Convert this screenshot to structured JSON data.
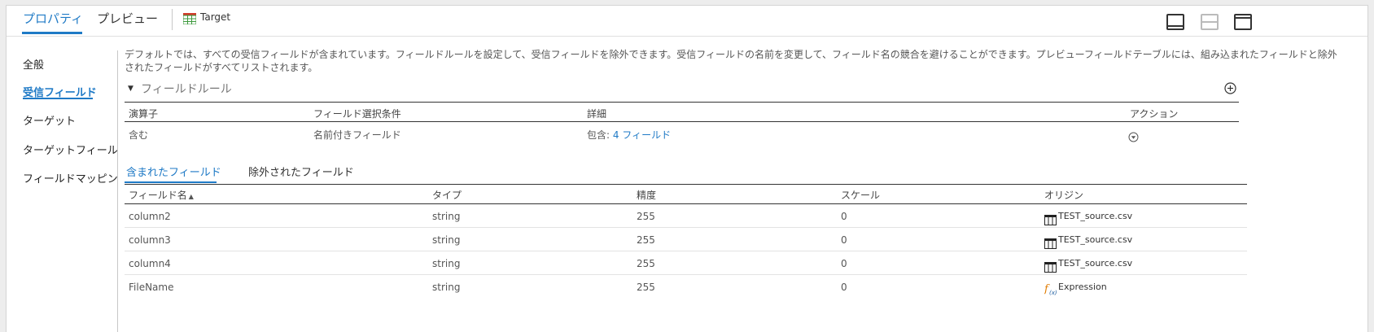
{
  "header": {
    "tabs": [
      {
        "label": "プロパティ",
        "active": true
      },
      {
        "label": "プレビュー",
        "active": false
      }
    ],
    "target": {
      "label": "Target",
      "icon": "target-table-icon"
    },
    "window_controls": [
      "dock-bottom-icon",
      "split-view-icon",
      "dock-top-icon"
    ]
  },
  "sidebar": {
    "items": [
      {
        "label": "全般",
        "active": false
      },
      {
        "label": "受信フィールド",
        "active": true
      },
      {
        "label": "ターゲット",
        "active": false
      },
      {
        "label": "ターゲットフィールド",
        "active": false
      },
      {
        "label": "フィールドマッピング",
        "active": false
      }
    ]
  },
  "main": {
    "description": "デフォルトでは、すべての受信フィールドが含まれています。フィールドルールを設定して、受信フィールドを除外できます。受信フィールドの名前を変更して、フィールド名の競合を避けることができます。プレビューフィールドテーブルには、組み込まれたフィールドと除外されたフィールドがすべてリストされます。",
    "rules_section": {
      "title": "フィールドルール",
      "headers": [
        "演算子",
        "フィールド選択条件",
        "詳細",
        "アクション"
      ],
      "rows": [
        {
          "operator": "含む",
          "criteria": "名前付きフィールド",
          "detail_prefix": "包含: ",
          "detail_link": "4 フィールド"
        }
      ]
    },
    "field_tabs": [
      {
        "label": "含まれたフィールド",
        "active": true
      },
      {
        "label": "除外されたフィールド",
        "active": false
      }
    ],
    "fields_table": {
      "headers": [
        "フィールド名",
        "タイプ",
        "精度",
        "スケール",
        "オリジン"
      ],
      "sort_indicator": "▲",
      "rows": [
        {
          "name": "column2",
          "type": "string",
          "precision": "255",
          "scale": "0",
          "origin": "TEST_source.csv",
          "origin_icon": "table-icon"
        },
        {
          "name": "column3",
          "type": "string",
          "precision": "255",
          "scale": "0",
          "origin": "TEST_source.csv",
          "origin_icon": "table-icon"
        },
        {
          "name": "column4",
          "type": "string",
          "precision": "255",
          "scale": "0",
          "origin": "TEST_source.csv",
          "origin_icon": "table-icon"
        },
        {
          "name": "FileName",
          "type": "string",
          "precision": "255",
          "scale": "0",
          "origin": "Expression",
          "origin_icon": "expression-icon"
        }
      ]
    }
  },
  "colors": {
    "accent": "#1f7ac6",
    "expression_icon": "#e07b00",
    "target_icon_green": "#3c9a3c",
    "target_icon_red": "#d23b2b"
  }
}
